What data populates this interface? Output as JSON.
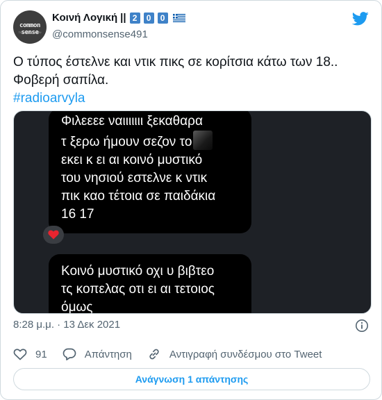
{
  "author": {
    "display_name": "Κοινή Λογική",
    "separator": "||",
    "number_digits": [
      "2",
      "0",
      "0"
    ],
    "handle": "@commonsense491",
    "avatar_text": "common sense",
    "avatar_subtext": "τοῦ καί σήμερον",
    "avatar_icon": "commonsense-avatar",
    "flag_icon": "greek-flag",
    "platform_icon": "twitter-bird-icon"
  },
  "tweet": {
    "lines": [
      "Ο τύπος έστελνε και ντικ πικς σε κορίτσια κάτω των 18..",
      "Φοβερή σαπίλα."
    ],
    "hashtag": "#radioarvyla"
  },
  "media": {
    "message1_lines": [
      "Φιλεεεε ναιιιιιιι ξεκαθαρα",
      "τ ξερω ήμουν σεζον το",
      "εκει κ ει αι κοινό μυστικό",
      "του νησιού εστελνε κ ντικ",
      "πικ καο τέτοια σε παιδάκια",
      "16 17"
    ],
    "reaction_icon": "red-heart-icon",
    "message2_lines": [
      "Κοινό μυστικό οχι υ βιβτεο",
      "τς κοπελας οτι ει αι τετοιος",
      "όμως"
    ]
  },
  "meta": {
    "timestamp": "8:28 μ.μ. · 13 Δεκ 2021",
    "info_icon": "info-icon"
  },
  "actions": {
    "like_count": "91",
    "reply_label": "Απάντηση",
    "copy_link_label": "Αντιγραφή συνδέσμου στο Tweet"
  },
  "read_replies_label": "Ανάγνωση 1 απάντησης",
  "colors": {
    "accent": "#1d9bf0",
    "secondary_text": "#536471",
    "border": "#cfd9de",
    "digit_box": "#3f82c8"
  }
}
